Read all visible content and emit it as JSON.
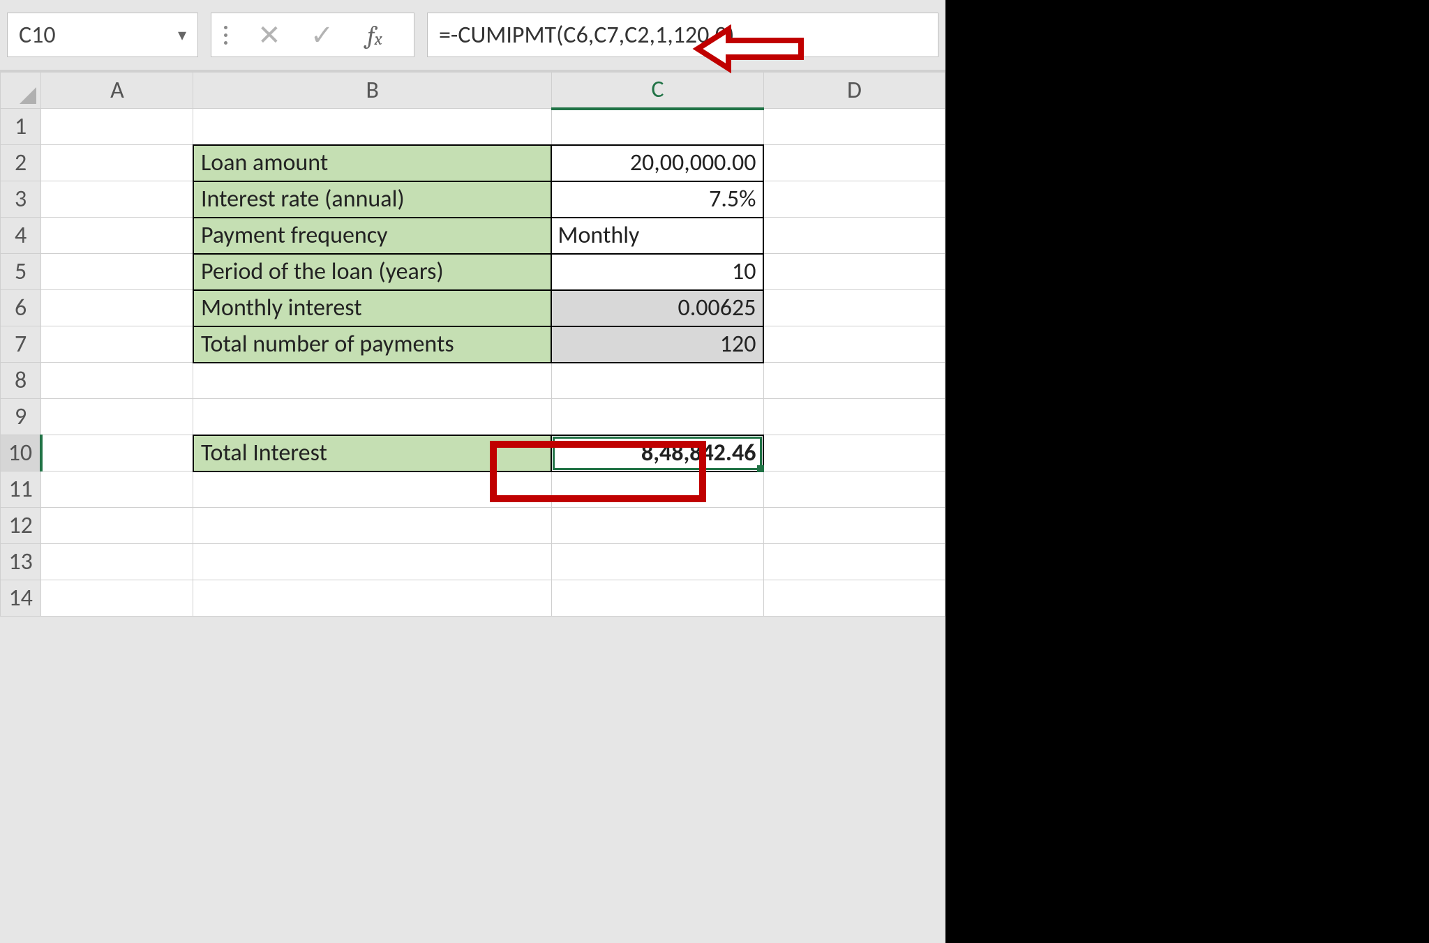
{
  "formula_bar": {
    "cell_reference": "C10",
    "formula": "=-CUMIPMT(C6,C7,C2,1,120,0)"
  },
  "columns": [
    "A",
    "B",
    "C",
    "D"
  ],
  "rows": [
    "1",
    "2",
    "3",
    "4",
    "5",
    "6",
    "7",
    "8",
    "9",
    "10",
    "11",
    "12",
    "13",
    "14"
  ],
  "data": {
    "loan_amount_label": "Loan amount",
    "loan_amount_value": "20,00,000.00",
    "interest_rate_label": "Interest rate (annual)",
    "interest_rate_value": "7.5%",
    "pay_freq_label": "Payment frequency",
    "pay_freq_value": "Monthly",
    "period_label": "Period of the loan (years)",
    "period_value": "10",
    "monthly_int_label": "Monthly interest",
    "monthly_int_value": "0.00625",
    "num_pay_label": "Total number of payments",
    "num_pay_value": "120",
    "total_int_label": "Total Interest",
    "total_int_value": "8,48,842.46"
  },
  "chart_data": {
    "type": "table",
    "rows": [
      {
        "parameter": "Loan amount",
        "value": "20,00,000.00"
      },
      {
        "parameter": "Interest rate (annual)",
        "value": "7.5%"
      },
      {
        "parameter": "Payment frequency",
        "value": "Monthly"
      },
      {
        "parameter": "Period of the loan (years)",
        "value": 10
      },
      {
        "parameter": "Monthly interest",
        "value": 0.00625
      },
      {
        "parameter": "Total number of payments",
        "value": 120
      },
      {
        "parameter": "Total Interest",
        "value": "8,48,842.46"
      }
    ],
    "formula_cell": "C10",
    "formula": "=-CUMIPMT(C6,C7,C2,1,120,0)"
  }
}
